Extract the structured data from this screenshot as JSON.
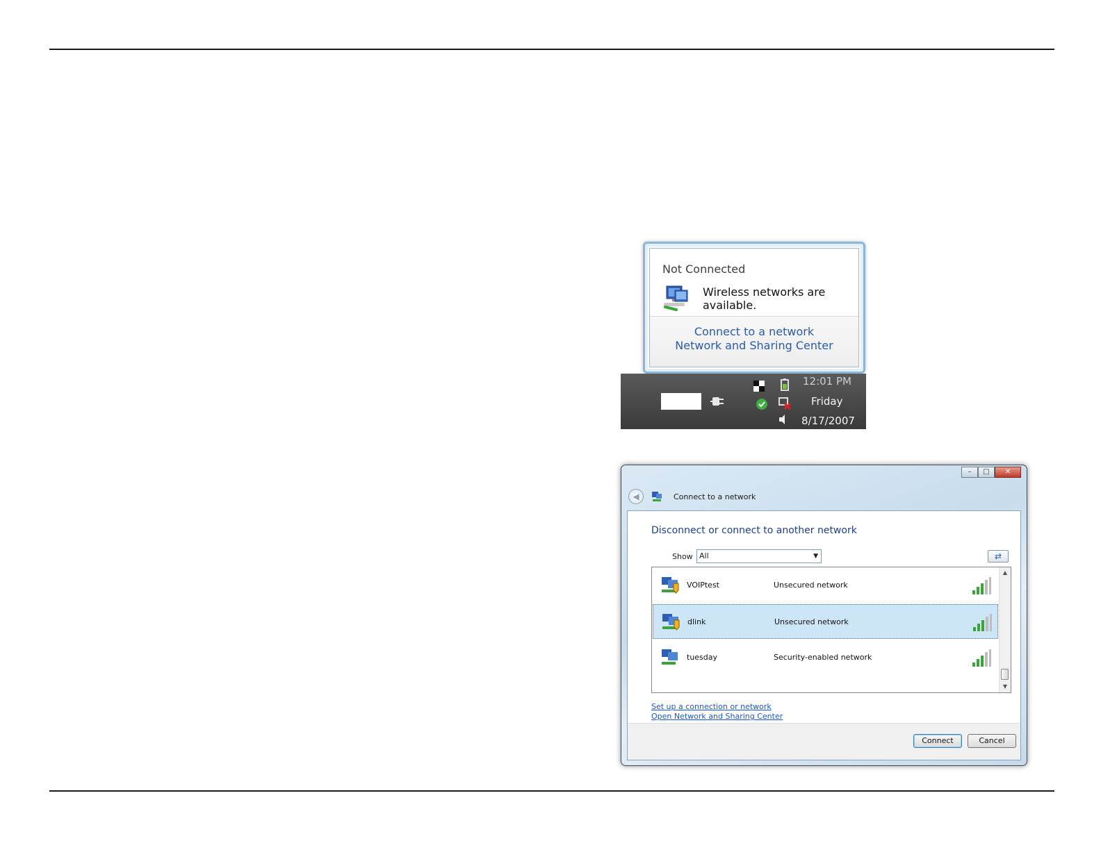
{
  "balloon": {
    "title": "Not Connected",
    "message": "Wireless networks are available.",
    "links": [
      "Connect to a network",
      "Network and Sharing Center"
    ]
  },
  "taskbar": {
    "time": "12:01 PM",
    "day": "Friday",
    "date": "8/17/2007"
  },
  "dialog": {
    "title": "Connect to a network",
    "heading": "Disconnect or connect to another network",
    "show_label": "Show",
    "show_value": "All",
    "networks": [
      {
        "name": "VOIPtest",
        "security": "Unsecured network",
        "selected": false
      },
      {
        "name": "dlink",
        "security": "Unsecured network",
        "selected": true
      },
      {
        "name": "tuesday",
        "security": "Security-enabled network",
        "selected": false
      }
    ],
    "links": [
      "Set up a connection or network",
      "Open Network and Sharing Center"
    ],
    "buttons": {
      "connect": "Connect",
      "cancel": "Cancel"
    }
  },
  "colors": {
    "link_blue": "#2b5aa3",
    "heading_blue": "#1e3f8a",
    "selected_row": "#cde6f7",
    "taskbar": "#4a4a4a"
  }
}
